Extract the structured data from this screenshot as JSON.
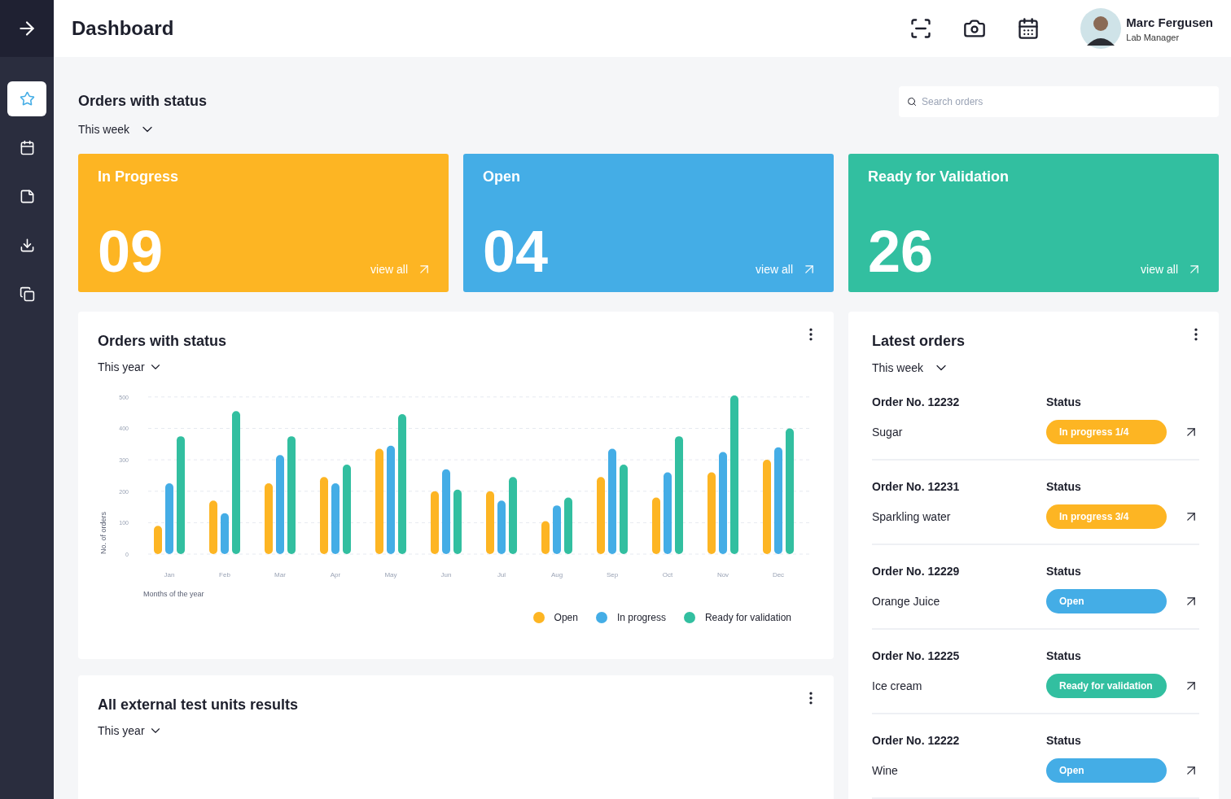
{
  "header": {
    "title": "Dashboard",
    "user": {
      "name": "Marc Fergusen",
      "role": "Lab Manager"
    }
  },
  "sidebar": {
    "items": [
      {
        "selected": true
      },
      {
        "selected": false
      },
      {
        "selected": false
      },
      {
        "selected": false
      },
      {
        "selected": false
      }
    ]
  },
  "overview": {
    "title": "Orders with status",
    "period": "This week",
    "search": {
      "placeholder": "Search orders"
    },
    "cards": [
      {
        "kind": "in_progress",
        "title": "In Progress",
        "count": "09",
        "link": "view all"
      },
      {
        "kind": "open",
        "title": "Open",
        "count": "04",
        "link": "view all"
      },
      {
        "kind": "ready",
        "title": "Ready for Validation",
        "count": "26",
        "link": "view all"
      }
    ]
  },
  "status_chart": {
    "title": "Orders with status",
    "period": "This year",
    "chart_data": {
      "type": "bar",
      "grid": true,
      "xlabel": "Months of the year",
      "ylabel": "No. of orders",
      "categories": [
        "Jan",
        "Feb",
        "Mar",
        "Apr",
        "May",
        "Jun",
        "Jul",
        "Aug",
        "Sep",
        "Oct",
        "Nov",
        "Dec"
      ],
      "ylim": [
        0,
        510
      ],
      "yticks": [
        0,
        100,
        200,
        300,
        400,
        500
      ],
      "series": [
        {
          "name": "Open",
          "color": "#fdb523",
          "values": [
            90,
            170,
            225,
            245,
            335,
            200,
            200,
            105,
            245,
            180,
            260,
            300
          ]
        },
        {
          "name": "In progress",
          "color": "#44ade6",
          "values": [
            225,
            130,
            315,
            225,
            345,
            270,
            170,
            155,
            335,
            260,
            325,
            340
          ]
        },
        {
          "name": "Ready for validation",
          "color": "#32bfa0",
          "values": [
            375,
            455,
            375,
            285,
            445,
            205,
            245,
            180,
            285,
            375,
            505,
            400
          ]
        }
      ]
    }
  },
  "test_units": {
    "title": "All external test units results",
    "period": "This year"
  },
  "latest_orders": {
    "title": "Latest orders",
    "period": "This week",
    "orders": [
      {
        "number": "Order No. 12232",
        "status_label": "Status",
        "product": "Sugar",
        "kind": "in_progress",
        "status": "In progress 1/4"
      },
      {
        "number": "Order No. 12231",
        "status_label": "Status",
        "product": "Sparkling water",
        "kind": "in_progress",
        "status": "In progress 3/4"
      },
      {
        "number": "Order No. 12229",
        "status_label": "Status",
        "product": "Orange Juice",
        "kind": "open",
        "status": "Open"
      },
      {
        "number": "Order No. 12225",
        "status_label": "Status",
        "product": "Ice cream",
        "kind": "ready",
        "status": "Ready for validation"
      },
      {
        "number": "Order No. 12222",
        "status_label": "Status",
        "product": "Wine",
        "kind": "open",
        "status": "Open"
      }
    ]
  }
}
